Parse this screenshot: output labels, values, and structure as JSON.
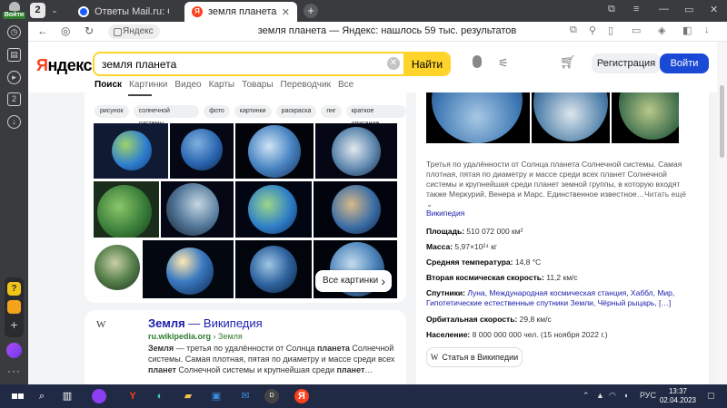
{
  "side_panel": {
    "enter_label": "Войти",
    "badge_count": "2"
  },
  "tabbar": {
    "tab_count": "2",
    "tabs": [
      {
        "title": "Ответы Mail.ru: Сколько /"
      },
      {
        "title": "земля планета — Яндекс"
      }
    ],
    "new_tab": "+"
  },
  "omnibox": {
    "site_label": "Яндекс",
    "page_title": "земля планета — Яндекс: нашлось 59 тыс. результатов"
  },
  "header": {
    "logo_main": "Я",
    "logo_rest": "ндекс",
    "search_value": "земля планета",
    "search_button": "Найти",
    "register": "Регистрация",
    "login": "Войти"
  },
  "nav_tabs": [
    "Поиск",
    "Картинки",
    "Видео",
    "Карты",
    "Товары",
    "Переводчик",
    "Все"
  ],
  "images": {
    "chips": [
      "рисунок",
      "солнечной системы",
      "фото",
      "картинки",
      "раскраска",
      "пнг",
      "краткое описание"
    ],
    "all_button": "Все картинки"
  },
  "wiki_result": {
    "logo": "W",
    "title_bold": "Земля",
    "title_rest": " — Википедия",
    "url_bold": "ru.wikipedia.org",
    "url_rest": " › Земля",
    "snippet_1": "Земля",
    "snippet_2": " — третья по удалённости от Солнца ",
    "snippet_3": "планета",
    "snippet_4": " Солнечной системы. Самая плотная, пятая по диаметру и массе среди всех ",
    "snippet_5": "планет",
    "snippet_6": " Солнечной системы и крупнейшая среди ",
    "snippet_7": "планет",
    "snippet_8": "…"
  },
  "knowledge_panel": {
    "description": "Третья по удалённости от Солнца планета Солнечной системы. Самая плотная, пятая по диаметру и массе среди всех планет Солнечной системы и крупнейшая среди планет земной группы, в которую входят также Меркурий, Венера и Марс. Единственное известное…",
    "read_more": "Читать ещё",
    "source": "Википедия",
    "facts": [
      {
        "label": "Площадь:",
        "value": "510 072 000 км²"
      },
      {
        "label": "Масса:",
        "value": "5,97×10²⁴ кг"
      },
      {
        "label": "Средняя температура:",
        "value": "14,8 °C"
      },
      {
        "label": "Вторая космическая скорость:",
        "value": "11,2 км/с"
      },
      {
        "label": "Спутники:",
        "value": "Луна, Международная космическая станция, Хаббл, Мир, Гипотетические естественные спутники Земли, Чёрный рыцарь, […]"
      },
      {
        "label": "Орбитальная скорость:",
        "value": "29,8 км/с"
      },
      {
        "label": "Население:",
        "value": "8 000 000 000 чел. (15 ноября 2022 г.)"
      }
    ],
    "wiki_button": "Статья в Википедии",
    "wiki_button_logo": "W"
  },
  "taskbar": {
    "lang": "РУС",
    "time": "13:37",
    "date": "02.04.2023"
  },
  "colors": {
    "yandex_red": "#fc3f1d",
    "search_yellow": "#fed42b",
    "login_blue": "#1a49d6",
    "link_blue": "#1a1dab",
    "url_green": "#2e7d2e"
  }
}
